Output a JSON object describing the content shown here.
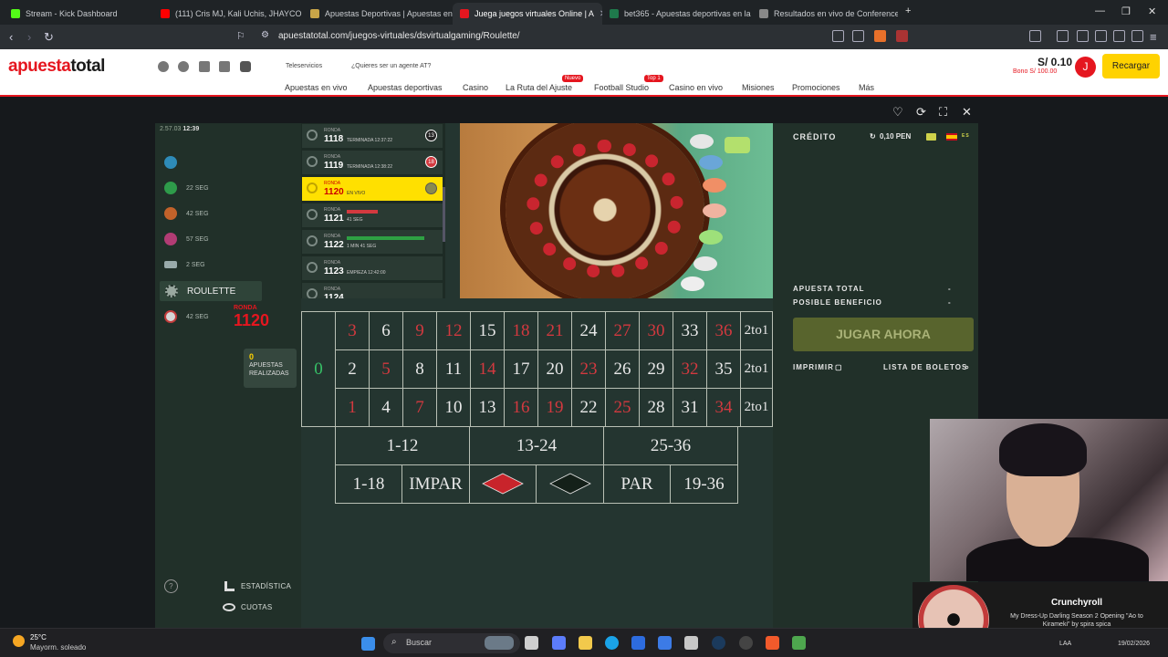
{
  "browser": {
    "tabs": [
      {
        "title": "Stream - Kick Dashboard",
        "color": "#53fc18"
      },
      {
        "title": "(111) Cris MJ, Kali Uchis, JHAYCO",
        "color": "#ff0000"
      },
      {
        "title": "Apuestas Deportivas | Apuestas en lí",
        "color": "#c8a548"
      },
      {
        "title": "Juega juegos virtuales Online | A",
        "color": "#e5161f"
      },
      {
        "title": "bet365 - Apuestas deportivas en la r",
        "color": "#1f7a4c"
      },
      {
        "title": "Resultados en vivo de Conference Le",
        "color": "#888888"
      }
    ],
    "url": "apuestatotal.com/juegos-virtuales/dsvirtualgaming/Roulette/"
  },
  "header": {
    "logo_part1": "apuesta",
    "logo_part2": "total",
    "teleservicios": "Teleservicios",
    "agent_question": "¿Quieres ser un agente AT?",
    "nav": [
      "Apuestas en vivo",
      "Apuestas deportivas",
      "Casino",
      "La Ruta del Ajuste",
      "Football Studio",
      "Casino en vivo",
      "Misiones",
      "Promociones",
      "Más"
    ],
    "badge_nuevo": "Nuevo",
    "badge_top": "Top 1",
    "balance": "S/ 0.10",
    "bonus": "Bono S/ 100.00",
    "avatar_letter": "J",
    "recargar": "Recargar"
  },
  "game": {
    "clock_date": "2.57.03",
    "clock_time": "12:39",
    "left_games": [
      {
        "label": "",
        "color": "#2e8bb8"
      },
      {
        "label": "22 SEG",
        "color": "#2e9b4a"
      },
      {
        "label": "42 SEG",
        "color": "#c2622a"
      },
      {
        "label": "57 SEG",
        "color": "#b23c74"
      },
      {
        "label": "2 SEG",
        "color": "#9aa"
      }
    ],
    "selected_game": "ROULETTE",
    "last_game_label": "42 SEG",
    "current_round_label": "RONDA",
    "current_round": "1120",
    "bets_count": "0",
    "bets_label": "APUESTAS REALIZADAS",
    "rounds": [
      {
        "label": "RONDA",
        "num": "1118",
        "status": "TERMINADA 12:37:22",
        "result": "13",
        "result_color": "#222222"
      },
      {
        "label": "RONDA",
        "num": "1119",
        "status": "TERMINADA 12:38:22",
        "result": "18",
        "result_color": "#d3393f"
      },
      {
        "label": "RONDA",
        "num": "1120",
        "status": "EN VIVO",
        "live": true
      },
      {
        "label": "RONDA",
        "num": "1121",
        "status": "41 SEG",
        "bar_color": "#d3393f",
        "progress": 0.45
      },
      {
        "label": "RONDA",
        "num": "1122",
        "status": "1 MIN 41 SEG",
        "bar_color": "#2ea043",
        "progress": 0.95
      },
      {
        "label": "RONDA",
        "num": "1123",
        "status": "EMPIEZA 12:42:00"
      },
      {
        "label": "RONDA",
        "num": "1124",
        "status": ""
      }
    ],
    "credito_label": "CRÉDITO",
    "credito_value": "0,10 PEN",
    "lang": "ES",
    "apuesta_total_label": "APUESTA TOTAL",
    "apuesta_total_value": "-",
    "posible_beneficio_label": "POSIBLE BENEFICIO",
    "posible_beneficio_value": "-",
    "jugar": "JUGAR AHORA",
    "imprimir": "IMPRIMIR",
    "lista": "LISTA DE BOLETOS",
    "estadistica": "ESTADÍSTICA",
    "cuotas": "CUOTAS",
    "zero": "0",
    "rows": [
      [
        {
          "n": "3",
          "c": "red"
        },
        {
          "n": "6",
          "c": "black"
        },
        {
          "n": "9",
          "c": "red"
        },
        {
          "n": "12",
          "c": "red"
        },
        {
          "n": "15",
          "c": "black"
        },
        {
          "n": "18",
          "c": "red"
        },
        {
          "n": "21",
          "c": "red"
        },
        {
          "n": "24",
          "c": "black"
        },
        {
          "n": "27",
          "c": "red"
        },
        {
          "n": "30",
          "c": "red"
        },
        {
          "n": "33",
          "c": "black"
        },
        {
          "n": "36",
          "c": "red"
        }
      ],
      [
        {
          "n": "2",
          "c": "black"
        },
        {
          "n": "5",
          "c": "red"
        },
        {
          "n": "8",
          "c": "black"
        },
        {
          "n": "11",
          "c": "black"
        },
        {
          "n": "14",
          "c": "red"
        },
        {
          "n": "17",
          "c": "black"
        },
        {
          "n": "20",
          "c": "black"
        },
        {
          "n": "23",
          "c": "red"
        },
        {
          "n": "26",
          "c": "black"
        },
        {
          "n": "29",
          "c": "black"
        },
        {
          "n": "32",
          "c": "red"
        },
        {
          "n": "35",
          "c": "black"
        }
      ],
      [
        {
          "n": "1",
          "c": "red"
        },
        {
          "n": "4",
          "c": "black"
        },
        {
          "n": "7",
          "c": "red"
        },
        {
          "n": "10",
          "c": "black"
        },
        {
          "n": "13",
          "c": "black"
        },
        {
          "n": "16",
          "c": "red"
        },
        {
          "n": "19",
          "c": "red"
        },
        {
          "n": "22",
          "c": "black"
        },
        {
          "n": "25",
          "c": "red"
        },
        {
          "n": "28",
          "c": "black"
        },
        {
          "n": "31",
          "c": "black"
        },
        {
          "n": "34",
          "c": "red"
        }
      ]
    ],
    "column_bet": "2to1",
    "dozens": [
      "1-12",
      "13-24",
      "25-36"
    ],
    "outside": [
      "1-18",
      "IMPAR",
      "",
      "",
      "PAR",
      "19-36"
    ]
  },
  "notification": {
    "title": "Crunchyroll",
    "text": "My Dress-Up Darling Season 2 Opening \"Ao to Kirameki\" by spira spica"
  },
  "taskbar": {
    "temperature": "25°C",
    "weather": "Mayorm. soleado",
    "search": "Buscar",
    "lang": "LAA",
    "date": "19/02/2026"
  }
}
